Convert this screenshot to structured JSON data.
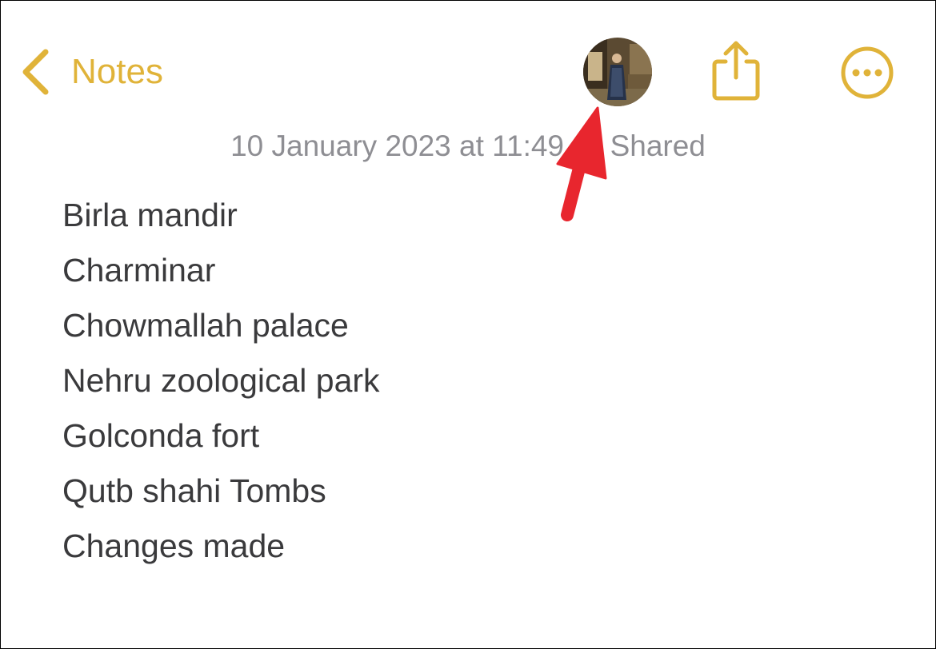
{
  "nav": {
    "back_label": "Notes",
    "back_icon": "chevron-left-icon",
    "actions": [
      {
        "name": "collaborator-avatar",
        "icon": "avatar-icon"
      },
      {
        "name": "share-button",
        "icon": "share-icon"
      },
      {
        "name": "more-button",
        "icon": "ellipsis-circle-icon"
      }
    ]
  },
  "note": {
    "meta": "10 January 2023 at 11:49 — Shared",
    "lines": [
      "Birla mandir",
      "Charminar",
      "Chowmallah palace",
      "Nehru zoological park",
      "Golconda fort",
      "Qutb shahi Tombs",
      "Changes made"
    ]
  },
  "annotation": {
    "icon": "red-arrow-icon",
    "color": "#e8262e"
  },
  "colors": {
    "accent": "#e0b339",
    "meta_text": "#8e8e93",
    "body_text": "#3a3a3c",
    "background": "#ffffff"
  }
}
